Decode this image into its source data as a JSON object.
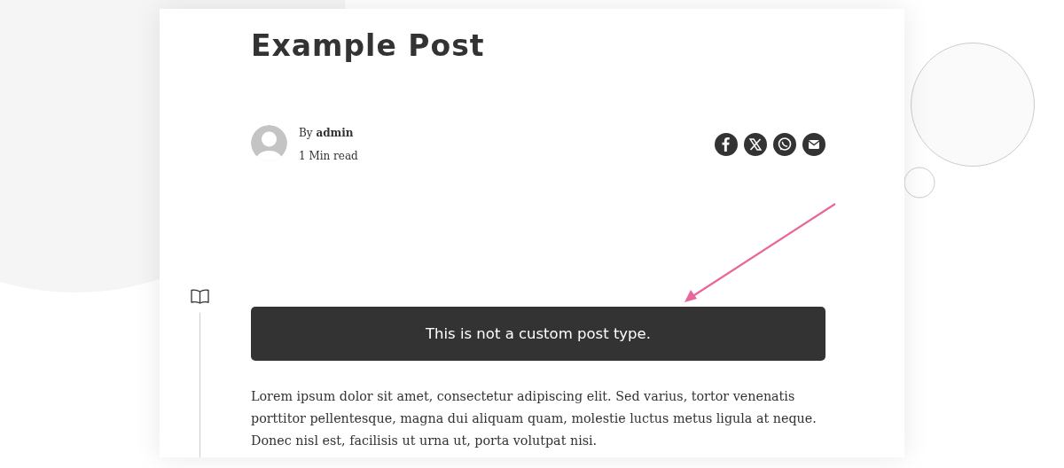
{
  "post": {
    "title": "Example Post",
    "author": {
      "byline": "By **admin**",
      "read_time": "1 Min read"
    },
    "share": [
      {
        "kind": "facebook"
      },
      {
        "kind": "x"
      },
      {
        "kind": "whatsapp"
      },
      {
        "kind": "email"
      }
    ],
    "notice": "This is not a custom post type.",
    "body": "Lorem ipsum dolor sit amet, consectetur adipiscing elit. Sed varius, tortor venenatis porttitor pellentesque, magna dui aliquam quam, molestie luctus metus ligula at neque. Donec nisl est, facilisis ut urna ut, porta volutpat nisi."
  }
}
